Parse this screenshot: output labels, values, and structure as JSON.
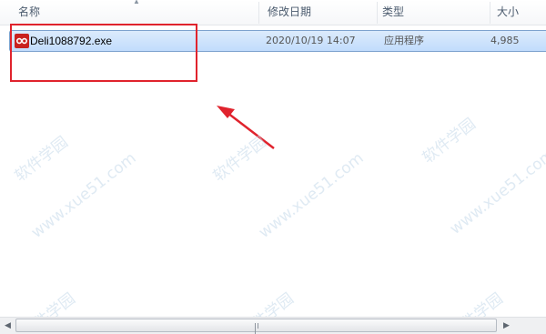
{
  "columns": {
    "name": "名称",
    "modified": "修改日期",
    "type": "类型",
    "size": "大小"
  },
  "files": [
    {
      "name": "Deli1088792.exe",
      "modified": "2020/10/19 14:07",
      "type": "应用程序",
      "size": "4,985",
      "icon": "exe-app-icon",
      "selected": true
    }
  ],
  "watermark": {
    "text1": "软件学园",
    "text2": "www.xue51.com"
  },
  "annotation": {
    "box_color": "#e0232d",
    "arrow_color": "#e0232d"
  },
  "scrollbar": {
    "left_arrow": "◀",
    "right_arrow": "▶",
    "up_arrow": "▲"
  }
}
